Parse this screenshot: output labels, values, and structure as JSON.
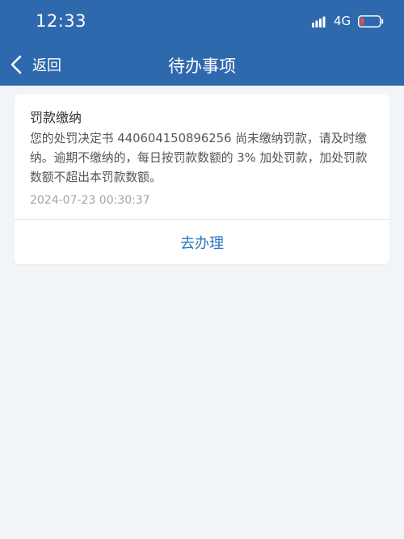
{
  "status_bar": {
    "time": "12:33",
    "network": "4G",
    "icons": [
      "signal-icon",
      "battery-icon"
    ]
  },
  "nav": {
    "back_label": "返回",
    "title": "待办事项",
    "back_icon": "chevron-left-icon"
  },
  "colors": {
    "header_bg": "#2f69ad",
    "page_bg": "#f2f5f8",
    "link": "#2f76c0",
    "battery_fill": "#d9534f"
  },
  "todo": {
    "title": "罚款缴纳",
    "message": "您的处罚决定书 440604150896256 尚未缴纳罚款，请及时缴纳。逾期不缴纳的，每日按罚款数额的 3% 加处罚款，加处罚款数额不超出本罚款数额。",
    "timestamp": "2024-07-23 00:30:37",
    "action_label": "去办理"
  }
}
